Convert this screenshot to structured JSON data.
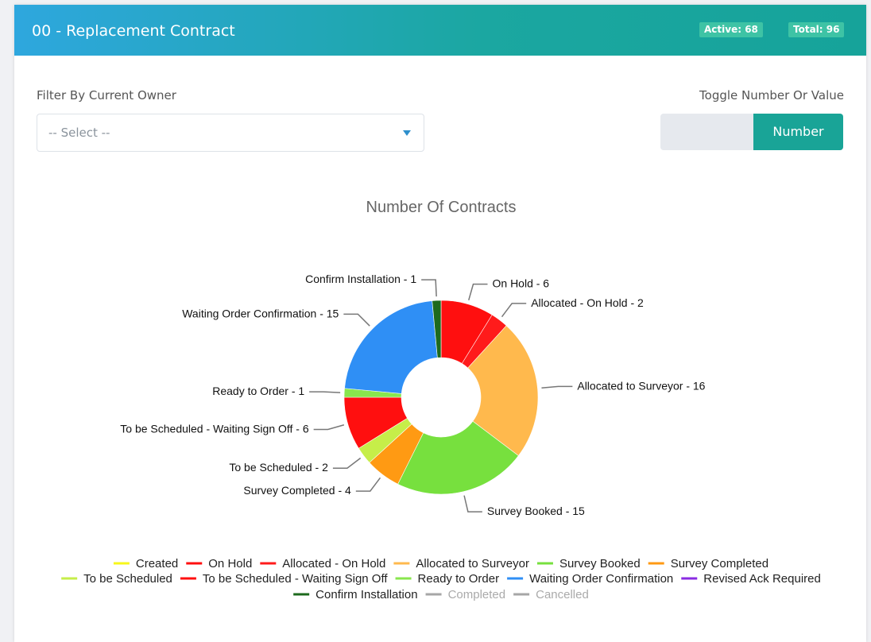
{
  "header": {
    "title": "00 - Replacement Contract",
    "active_badge": "Active: 68",
    "total_badge": "Total: 96"
  },
  "filter": {
    "label": "Filter By Current Owner",
    "placeholder": "-- Select --"
  },
  "toggle": {
    "label": "Toggle Number Or Value",
    "active_option": "Number"
  },
  "chart_data": {
    "type": "pie",
    "variant": "donut",
    "title": "Number Of Contracts",
    "slices": [
      {
        "name": "On Hold",
        "value": 6,
        "label": "On Hold - 6",
        "color": "#ff0f0f"
      },
      {
        "name": "Allocated - On Hold",
        "value": 2,
        "label": "Allocated - On Hold - 2",
        "color": "#ff1b1b"
      },
      {
        "name": "Allocated to Surveyor",
        "value": 16,
        "label": "Allocated to Surveyor - 16",
        "color": "#ffb94d"
      },
      {
        "name": "Survey Booked",
        "value": 15,
        "label": "Survey Booked - 15",
        "color": "#77e03e"
      },
      {
        "name": "Survey Completed",
        "value": 4,
        "label": "Survey Completed - 4",
        "color": "#ff9a13"
      },
      {
        "name": "To be Scheduled",
        "value": 2,
        "label": "To be Scheduled - 2",
        "color": "#c6ee49"
      },
      {
        "name": "To be Scheduled - Waiting Sign Off",
        "value": 6,
        "label": "To be Scheduled - Waiting Sign Off - 6",
        "color": "#ff0f0f"
      },
      {
        "name": "Ready to Order",
        "value": 1,
        "label": "Ready to Order - 1",
        "color": "#89e64d"
      },
      {
        "name": "Waiting Order Confirmation",
        "value": 15,
        "label": "Waiting Order Confirmation - 15",
        "color": "#2f8ff5"
      },
      {
        "name": "Confirm Installation",
        "value": 1,
        "label": "Confirm Installation - 1",
        "color": "#1d6a1d"
      }
    ],
    "legend": [
      {
        "label": "Created",
        "color": "#f7f71a",
        "muted": false
      },
      {
        "label": "On Hold",
        "color": "#ff0f0f",
        "muted": false
      },
      {
        "label": "Allocated - On Hold",
        "color": "#ff1b1b",
        "muted": false
      },
      {
        "label": "Allocated to Surveyor",
        "color": "#ffb94d",
        "muted": false
      },
      {
        "label": "Survey Booked",
        "color": "#77e03e",
        "muted": false
      },
      {
        "label": "Survey Completed",
        "color": "#ff9a13",
        "muted": false
      },
      {
        "label": "To be Scheduled",
        "color": "#c6ee49",
        "muted": false
      },
      {
        "label": "To be Scheduled - Waiting Sign Off",
        "color": "#ff0f0f",
        "muted": false
      },
      {
        "label": "Ready to Order",
        "color": "#89e64d",
        "muted": false
      },
      {
        "label": "Waiting Order Confirmation",
        "color": "#2f8ff5",
        "muted": false
      },
      {
        "label": "Revised Ack Required",
        "color": "#8a2be2",
        "muted": false
      },
      {
        "label": "Confirm Installation",
        "color": "#1d6a1d",
        "muted": false
      },
      {
        "label": "Completed",
        "color": "#a6a6a6",
        "muted": true
      },
      {
        "label": "Cancelled",
        "color": "#a6a6a6",
        "muted": true
      }
    ],
    "legend_placement": "bottom-center"
  }
}
